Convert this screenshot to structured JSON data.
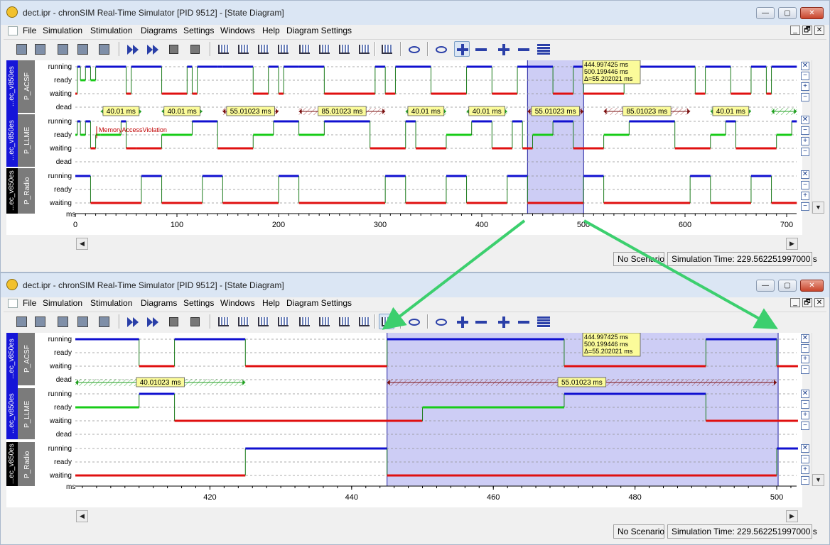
{
  "windows": [
    {
      "title": "dect.ipr - chronSIM Real-Time Simulator [PID 9512] - [State Diagram]",
      "menu": [
        "File",
        "Simulation",
        "Stimulation",
        "Diagrams",
        "Settings",
        "Windows",
        "Help",
        "Diagram Settings"
      ],
      "controls": {
        "min": "—",
        "max": "▢",
        "close": "✕"
      },
      "status": {
        "scenario": "No Scenario",
        "time": "Simulation Time: 229.562251997000 s"
      }
    },
    {
      "title": "dect.ipr - chronSIM Real-Time Simulator [PID 9512] - [State Diagram]",
      "menu": [
        "File",
        "Simulation",
        "Stimulation",
        "Diagrams",
        "Settings",
        "Windows",
        "Help",
        "Diagram Settings"
      ],
      "controls": {
        "min": "—",
        "max": "▢",
        "close": "✕"
      },
      "status": {
        "scenario": "No Scenario",
        "time": "Simulation Time: 229.562251997000 s"
      }
    }
  ],
  "mdi_controls": [
    "_",
    "🗗",
    "✕"
  ],
  "toolbar_icons": [
    "open-project-icon",
    "save-project-icon",
    "settings-gear-icon",
    "report-icon",
    "print-icon",
    "run-fast-icon",
    "step-icon",
    "pause-icon",
    "stop-icon",
    "state-diagram-icon",
    "task-diagram-icon",
    "hatched-diagram-icon",
    "histogram-icon",
    "boxplot-icon",
    "curve-icon",
    "line-icon",
    "cross-icon",
    "wave-diagram-icon",
    "eye-icon",
    "zoom-in-icon",
    "zoom-out-icon",
    "zoom-fit-icon",
    "plus-icon",
    "minus-icon",
    "list-icon"
  ],
  "task_groups": [
    {
      "cpu": "...ec_v850es",
      "process": "P_ACSF",
      "states": [
        "running",
        "ready",
        "waiting",
        "dead"
      ]
    },
    {
      "cpu": "...ec_v850es",
      "process": "P_LLME",
      "states": [
        "running",
        "ready",
        "waiting",
        "dead"
      ]
    },
    {
      "cpu": "...ec_v850es",
      "process": "P_Radio",
      "states": [
        "running",
        "ready",
        "waiting"
      ]
    }
  ],
  "right_buttons": [
    "✕",
    "−",
    "+",
    "−"
  ],
  "axis_unit": "ms",
  "top_axis": {
    "ticks": [
      "0",
      "100",
      "200",
      "300",
      "400",
      "500",
      "600",
      "700"
    ]
  },
  "bottom_axis": {
    "ticks": [
      "420",
      "440",
      "460",
      "480",
      "500"
    ]
  },
  "measurement_tooltip": {
    "line1": "444.997425 ms",
    "line2": "500.199446 ms",
    "line3": "Δ=55.202021 ms"
  },
  "top_period_labels": [
    "40.01 ms",
    "40.01 ms",
    "55.01023 ms",
    "85.01023 ms",
    "40.01 ms",
    "40.01 ms",
    "55.01023 ms",
    "85.01023 ms",
    "40.01 ms"
  ],
  "bottom_period_labels": [
    "40.01023 ms",
    "55.01023 ms"
  ],
  "violation_label": "MemoryAccessViolation",
  "colors": {
    "running": "#1010d0",
    "ready": "#18cc18",
    "waiting": "#e01010",
    "selection": "#c8c8f4",
    "arrow": "#3ccf6e",
    "sidebar_blue": "#1515d8"
  }
}
